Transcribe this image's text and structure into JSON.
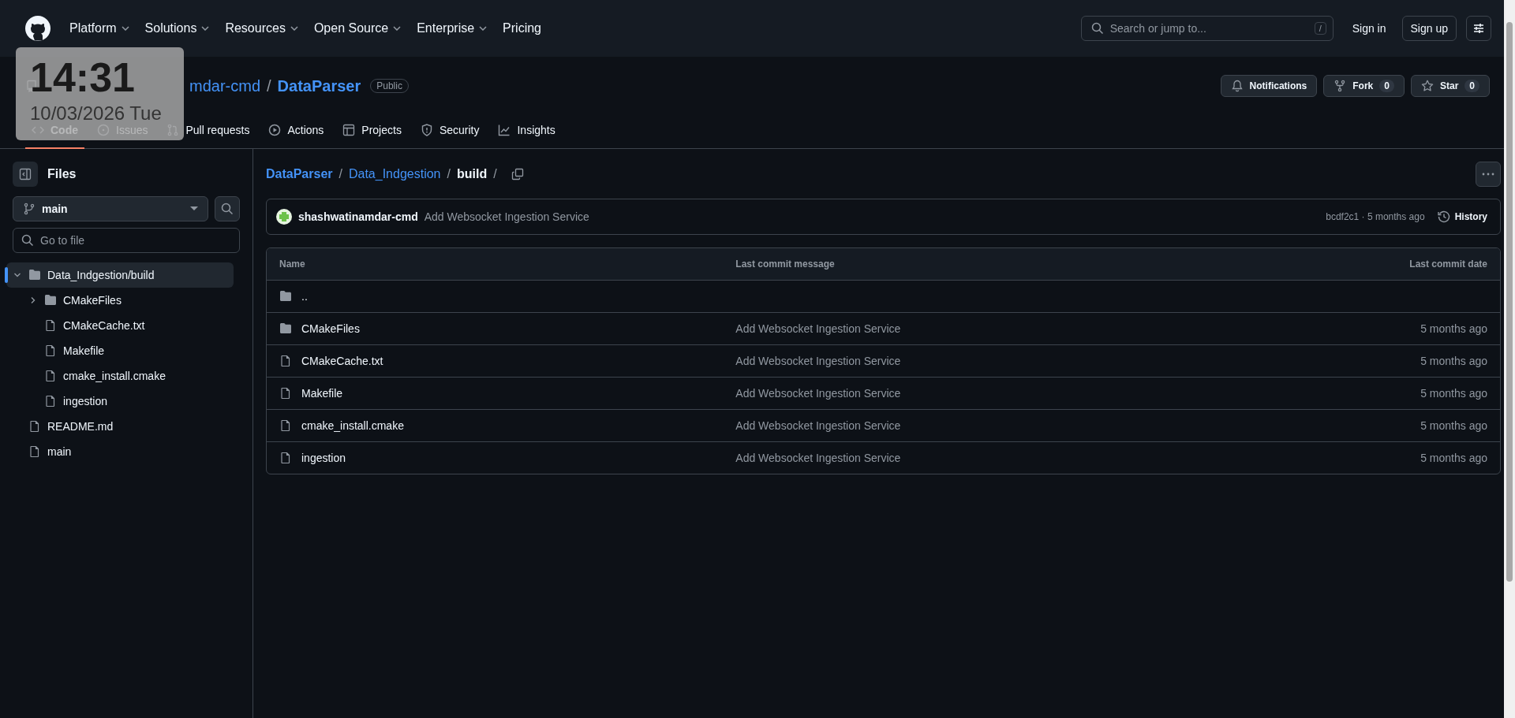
{
  "header": {
    "nav": [
      {
        "label": "Platform",
        "dropdown": true
      },
      {
        "label": "Solutions",
        "dropdown": true
      },
      {
        "label": "Resources",
        "dropdown": true
      },
      {
        "label": "Open Source",
        "dropdown": true
      },
      {
        "label": "Enterprise",
        "dropdown": true
      },
      {
        "label": "Pricing",
        "dropdown": false
      }
    ],
    "search": {
      "placeholder": "Search or jump to...",
      "shortcut": "/"
    },
    "sign_in": "Sign in",
    "sign_up": "Sign up"
  },
  "repo": {
    "owner": "mdar-cmd",
    "separator": "/",
    "name": "DataParser",
    "visibility": "Public",
    "actions": [
      {
        "kind": "bell",
        "label": "Notifications"
      },
      {
        "kind": "fork",
        "label": "Fork",
        "count": "0"
      },
      {
        "kind": "star",
        "label": "Star",
        "count": "0"
      }
    ],
    "tabs": [
      {
        "kind": "code",
        "label": "Code",
        "selected": true
      },
      {
        "kind": "issues",
        "label": "Issues",
        "selected": false
      },
      {
        "kind": "pulls",
        "label": "Pull requests",
        "selected": false
      },
      {
        "kind": "actions",
        "label": "Actions",
        "selected": false
      },
      {
        "kind": "projects",
        "label": "Projects",
        "selected": false
      },
      {
        "kind": "security",
        "label": "Security",
        "selected": false
      },
      {
        "kind": "insights",
        "label": "Insights",
        "selected": false
      }
    ]
  },
  "sidebar": {
    "title": "Files",
    "branch": "main",
    "search": {
      "placeholder": "Go to file"
    },
    "tree": [
      {
        "name": "Data_Indgestion/build",
        "kind": "folder",
        "expanded": true,
        "selected": true,
        "children": [
          {
            "name": "CMakeFiles",
            "kind": "folder",
            "expanded": false,
            "selected": false
          },
          {
            "name": "CMakeCache.txt",
            "kind": "file",
            "selected": false
          },
          {
            "name": "Makefile",
            "kind": "file",
            "selected": false
          },
          {
            "name": "cmake_install.cmake",
            "kind": "file",
            "selected": false
          },
          {
            "name": "ingestion",
            "kind": "file",
            "selected": false
          }
        ]
      },
      {
        "name": "README.md",
        "kind": "file",
        "selected": false
      },
      {
        "name": "main",
        "kind": "file",
        "selected": false
      }
    ]
  },
  "breadcrumb": [
    {
      "label": "DataParser",
      "kind": "repo",
      "separator": "/"
    },
    {
      "label": "Data_Indgestion",
      "kind": "dir",
      "separator": "/"
    },
    {
      "label": "build",
      "kind": "current",
      "separator": "/"
    }
  ],
  "latest_commit": {
    "author": "shashwatinamdar-cmd",
    "message": "Add Websocket Ingestion Service",
    "hash": "bcdf2c1 · 5 months ago",
    "history": "History"
  },
  "table": {
    "columns": [
      "Name",
      "Last commit message",
      "Last commit date"
    ],
    "rows": [
      {
        "kind": "folder",
        "name": ".."
      },
      {
        "kind": "folder",
        "name": "CMakeFiles",
        "message": "Add Websocket Ingestion Service",
        "date": "5 months ago"
      },
      {
        "kind": "file",
        "name": "CMakeCache.txt",
        "message": "Add Websocket Ingestion Service",
        "date": "5 months ago"
      },
      {
        "kind": "file",
        "name": "Makefile",
        "message": "Add Websocket Ingestion Service",
        "date": "5 months ago"
      },
      {
        "kind": "file",
        "name": "cmake_install.cmake",
        "message": "Add Websocket Ingestion Service",
        "date": "5 months ago"
      },
      {
        "kind": "file",
        "name": "ingestion",
        "message": "Add Websocket Ingestion Service",
        "date": "5 months ago"
      }
    ]
  },
  "clock": {
    "time": "14:31",
    "date": "10/03/2026 Tue"
  }
}
